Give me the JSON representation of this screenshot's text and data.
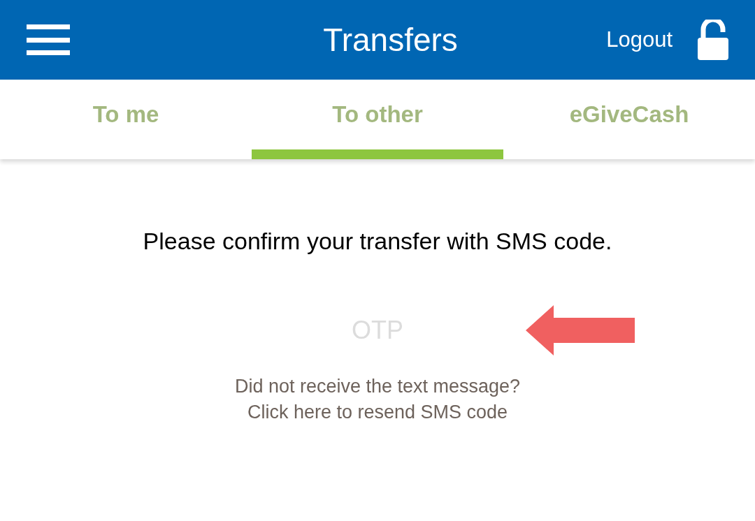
{
  "header": {
    "title": "Transfers",
    "logout": "Logout"
  },
  "tabs": [
    {
      "label": "To me",
      "selected": false
    },
    {
      "label": "To other",
      "selected": true
    },
    {
      "label": "eGiveCash",
      "selected": false
    }
  ],
  "message": "Please confirm your transfer with SMS code.",
  "otp_field": {
    "placeholder": "OTP"
  },
  "resend": {
    "question": "Did not receive the text message?",
    "link": "Click here to resend SMS code"
  }
}
